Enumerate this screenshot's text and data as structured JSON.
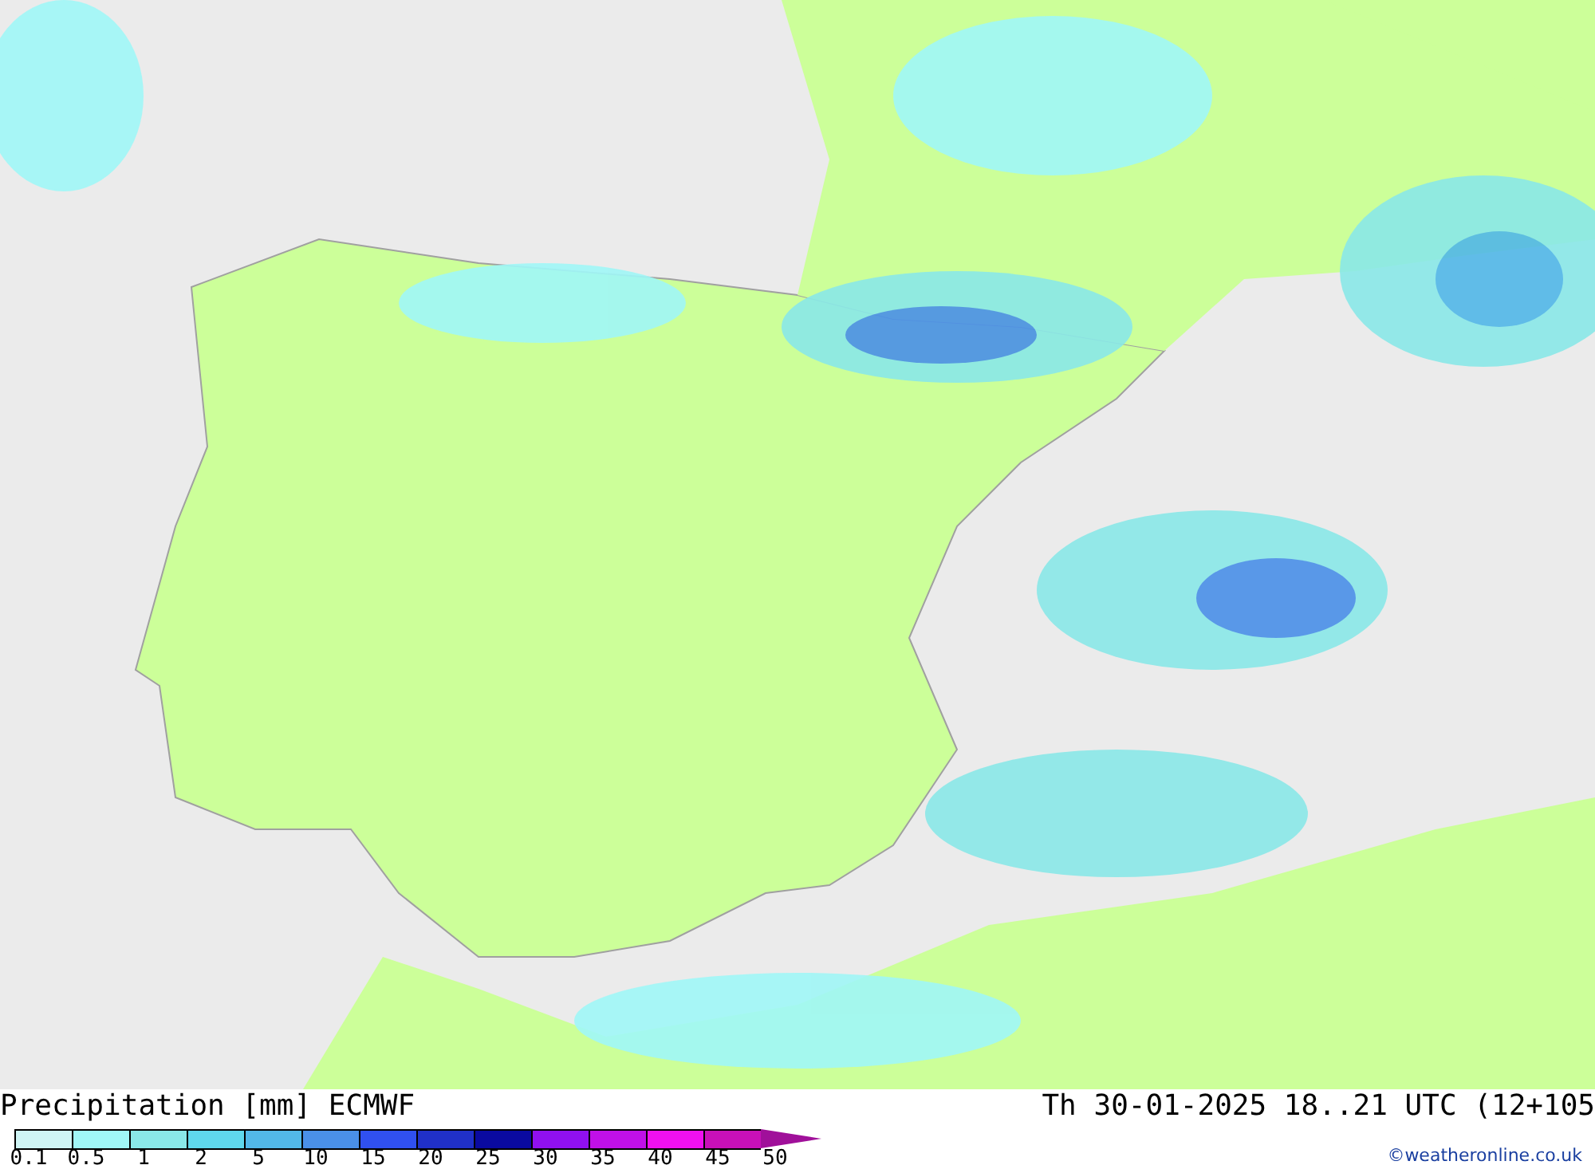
{
  "title": "Precipitation [mm] ECMWF",
  "valid_time": "Th 30-01-2025 18..21 UTC (12+105",
  "legend": {
    "bins": [
      {
        "color": "#cff5f5"
      },
      {
        "color": "#a0f7f7"
      },
      {
        "color": "#8ae8e8"
      },
      {
        "color": "#5fd8ec"
      },
      {
        "color": "#52b8e8"
      },
      {
        "color": "#4a90e8"
      },
      {
        "color": "#3050f0"
      },
      {
        "color": "#2030c8"
      },
      {
        "color": "#0a0aa0"
      },
      {
        "color": "#9010f0"
      },
      {
        "color": "#c010e8"
      },
      {
        "color": "#f010f0"
      },
      {
        "color": "#c810b8"
      }
    ],
    "labels": [
      "0.1",
      "0.5",
      "1",
      "2",
      "5",
      "10",
      "15",
      "20",
      "25",
      "30",
      "35",
      "40",
      "45",
      "50"
    ]
  },
  "copyright": "©weatheronline.co.uk"
}
